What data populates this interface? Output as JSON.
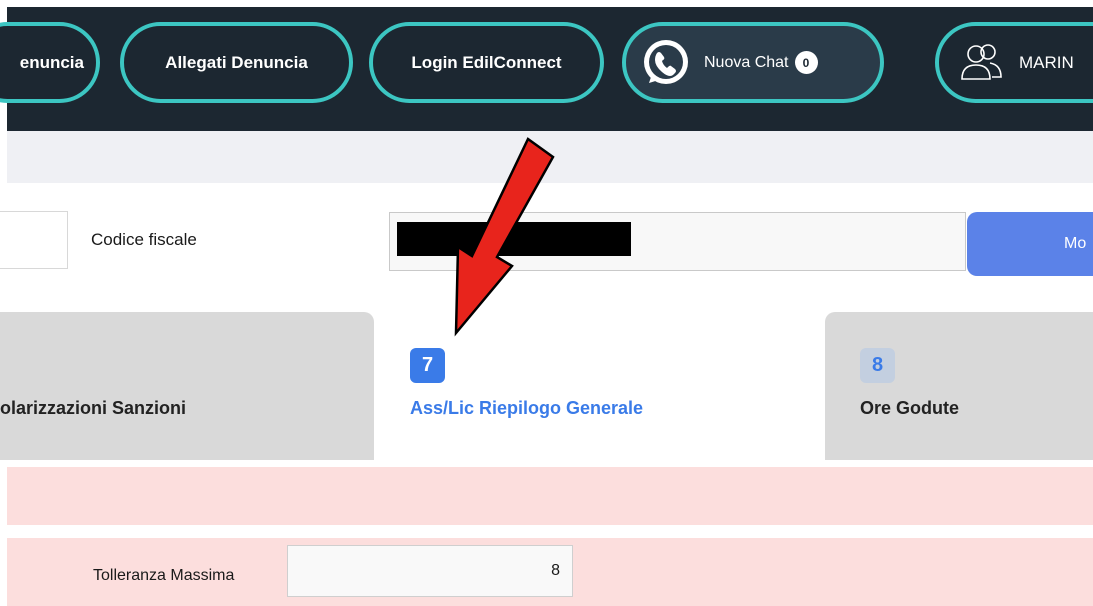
{
  "topbar": {
    "buttons": {
      "denuncia": "enuncia",
      "allegati": "Allegati Denuncia",
      "login": "Login EdilConnect"
    },
    "chat": {
      "label": "Nuova Chat",
      "count": "0",
      "icon": "whatsapp-icon"
    },
    "user": {
      "name": "MARIN",
      "icon": "user-group-icon"
    }
  },
  "form": {
    "codice_fiscale_label": "Codice fiscale",
    "codice_fiscale_value": "",
    "mostra_label": "Mo"
  },
  "tabs": [
    {
      "number": "",
      "label": "olarizzazioni Sanzioni",
      "active": false
    },
    {
      "number": "7",
      "label": "Ass/Lic Riepilogo Generale",
      "active": true
    },
    {
      "number": "8",
      "label": "Ore Godute",
      "active": false
    }
  ],
  "tolleranza": {
    "label": "Tolleranza Massima",
    "value": "8"
  },
  "colors": {
    "topbar_bg": "#1c2731",
    "pill_border": "#3cc6c2",
    "primary": "#5b82e8",
    "tab_active": "#3a7be8",
    "pink_panel": "#fcdedd",
    "annotation_arrow": "#e8241c"
  }
}
